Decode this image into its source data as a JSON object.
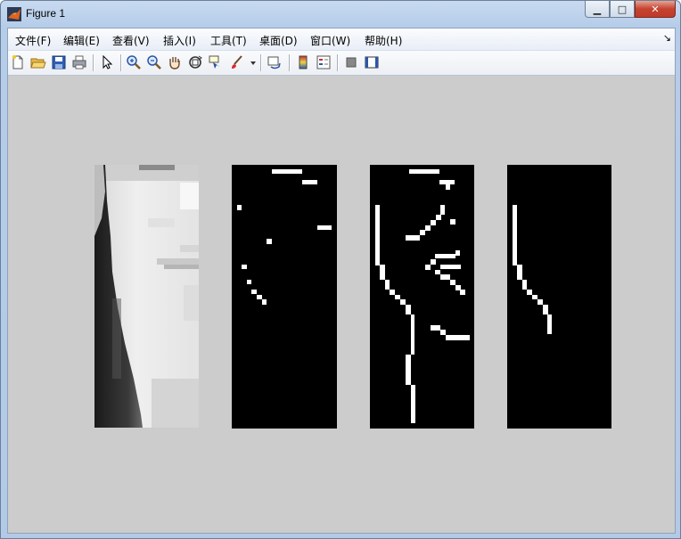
{
  "window": {
    "title": "Figure 1",
    "controls": {
      "minimize": "▁",
      "maximize": "□",
      "close": "✕"
    }
  },
  "menubar": {
    "items": [
      "文件(F)",
      "编辑(E)",
      "查看(V)",
      "插入(I)",
      "工具(T)",
      "桌面(D)",
      "窗口(W)",
      "帮助(H)"
    ],
    "dock_icon": "dock-arrow-icon"
  },
  "toolbar": {
    "buttons": [
      "new-figure-icon",
      "open-file-icon",
      "save-icon",
      "print-icon",
      "pointer-icon",
      "zoom-in-icon",
      "zoom-out-icon",
      "pan-hand-icon",
      "rotate-3d-icon",
      "data-cursor-icon",
      "brush-icon",
      "link-plot-icon",
      "colorbar-icon",
      "legend-icon",
      "hide-plot-tools-icon",
      "show-plot-tools-icon"
    ]
  },
  "figure": {
    "background": "#cccccc",
    "subplots": [
      {
        "kind": "grayscale-image",
        "content": "face-profile"
      },
      {
        "kind": "binary-edge-image",
        "content": "sparse-edges"
      },
      {
        "kind": "binary-edge-image",
        "content": "dense-edges"
      },
      {
        "kind": "binary-edge-image",
        "content": "contour-edge"
      }
    ]
  }
}
